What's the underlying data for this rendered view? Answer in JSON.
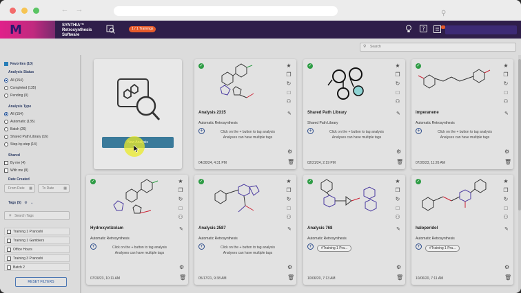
{
  "app": {
    "brand_line1": "SYNTHIA™",
    "brand_line2": "Retrosynthesis",
    "brand_line3": "Software",
    "logo_letter": "M",
    "trainings_badge": "1 / 1 Trainings"
  },
  "main": {
    "search_placeholder": "Search"
  },
  "sidebar": {
    "favorites": "Favorites (10)",
    "analysis_status_head": "Analysis Status",
    "status_options": [
      "All (154)",
      "Completed (135)",
      "Pending (0)"
    ],
    "analysis_type_head": "Analysis Type",
    "type_options": [
      "All (154)",
      "Automatic (135)",
      "Batch (26)",
      "Shared Path Library (16)",
      "Step-by-step (14)"
    ],
    "shared_head": "Shared",
    "shared_options": [
      "By me (4)",
      "With me (8)"
    ],
    "date_head": "Date Created",
    "from_date": "From Date",
    "to_date": "To Date",
    "tags_head": "Tags (5)",
    "tag_search_placeholder": "Search Tags",
    "tags": [
      "Training 1 Pranoshi",
      "Training 1 Gamblers",
      "Office Hours",
      "Training 3 Pranoshi",
      "Batch 2"
    ],
    "reset_label": "RESET FILTERS"
  },
  "new_card": {
    "button_label": "New Analysis"
  },
  "cards": [
    {
      "title": "Analysis 2315",
      "type": "Automatic Retrosynthesis",
      "hint1": "Click on the + button to tag analysis",
      "hint2": "Analyses can have multiple tags",
      "tag": "",
      "date": "04/30/24, 4:31 PM"
    },
    {
      "title": "Shared Path Library",
      "type": "Shared Path Library",
      "hint1": "Click on the + button to tag analysis",
      "hint2": "Analyses can have multiple tags",
      "tag": "",
      "date": "02/21/24, 2:19 PM"
    },
    {
      "title": "imperanene",
      "type": "Automatic Retrosynthesis",
      "hint1": "Click on the + button to tag analysis",
      "hint2": "Analyses can have multiple tags",
      "tag": "",
      "date": "07/20/23, 11:26 AM"
    },
    {
      "title": "Hydroxyetizolam",
      "type": "Automatic Retrosynthesis",
      "hint1": "Click on the + button to tag analysis",
      "hint2": "Analyses can have multiple tags",
      "tag": "",
      "date": "07/20/23, 10:11 AM"
    },
    {
      "title": "Analysis 2587",
      "type": "Automatic Retrosynthesis",
      "hint1": "Click on the + button to tag analysis",
      "hint2": "Analyses can have multiple tags",
      "tag": "",
      "date": "05/17/21, 9:38 AM"
    },
    {
      "title": "Analysis 768",
      "type": "Automatic Retrosynthesis",
      "hint1": "",
      "hint2": "",
      "tag": "#Training 1 Pra...",
      "date": "10/06/20, 7:13 AM"
    },
    {
      "title": "haloperidol",
      "type": "Automatic Retrosynthesis",
      "hint1": "",
      "hint2": "",
      "tag": "#Training 1 Pra...",
      "date": "10/06/20, 7:11 AM"
    }
  ],
  "colors": {
    "header_bg": "#2f1e4a",
    "logo_pink": "#e0218a",
    "status_green": "#2e9c45",
    "accent_blue": "#1c4c93"
  }
}
